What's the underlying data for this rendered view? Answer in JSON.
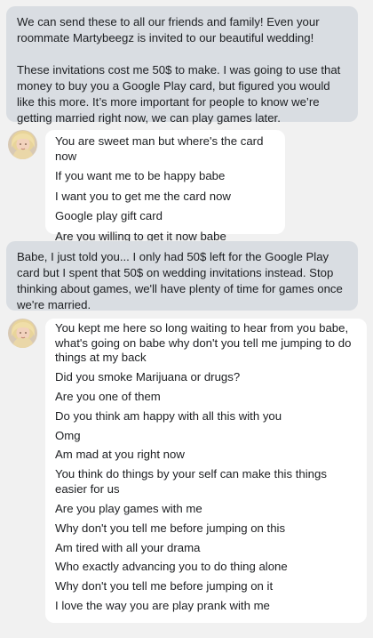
{
  "outgoing": [
    {
      "paragraphs": [
        "We can send these to all our friends and family! Even your roommate Martybeegz is invited to our beautiful wedding!",
        "These invitations cost me 50$ to make. I was going to use that money to buy you a Google Play card, but figured you would like this more. It’s more important for people to know we’re getting married right now, we can play games later."
      ]
    },
    {
      "paragraphs": [
        "Babe, I just told you... I only had 50$ left for the Google Play card but I spent that 50$ on wedding invitations instead. Stop thinking about games, we'll have plenty of time for games once we're married."
      ]
    }
  ],
  "incoming": [
    {
      "avatar_icon": "user-avatar-blonde",
      "messages": [
        "You are sweet man but where's the card now",
        "If you want me to be happy babe",
        "I want you to get me the card now",
        "Google play gift card",
        "Are you willing to get it now babe"
      ]
    },
    {
      "avatar_icon": "user-avatar-blonde",
      "messages": [
        "You kept me here so long waiting to hear from you babe, what's going on babe why don't you tell me jumping to do things at my back",
        "Did you smoke Marijuana or drugs?",
        "Are you one of them",
        "Do you think am happy with all this with you",
        "Omg",
        "Am mad at you right now",
        "You think do things by your self can make this things easier for us",
        "Are you play games with me",
        "Why don't you tell me before jumping on this",
        "Am tired with all your drama",
        "Who exactly advancing you to do thing alone",
        "Why don't you tell me before jumping on it",
        "I love the way you are play prank with me"
      ]
    }
  ],
  "colors": {
    "background": "#f1f1f1",
    "outgoing_bubble": "#d9dde2",
    "incoming_bubble": "#ffffff",
    "text": "#1c1e21"
  }
}
